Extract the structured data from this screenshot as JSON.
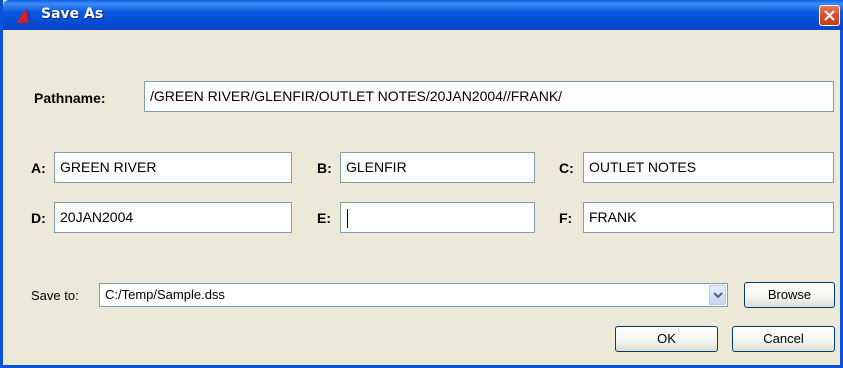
{
  "window": {
    "title": "Save As",
    "app_icon": "triangle-app-icon",
    "close_icon": "close-icon"
  },
  "pathname": {
    "label": "Pathname:",
    "value": "/GREEN RIVER/GLENFIR/OUTLET NOTES/20JAN2004//FRANK/"
  },
  "parts": {
    "a": {
      "label": "A:",
      "value": "GREEN RIVER"
    },
    "b": {
      "label": "B:",
      "value": "GLENFIR"
    },
    "c": {
      "label": "C:",
      "value": "OUTLET NOTES"
    },
    "d": {
      "label": "D:",
      "value": "20JAN2004"
    },
    "e": {
      "label": "E:",
      "value": ""
    },
    "f": {
      "label": "F:",
      "value": "FRANK"
    }
  },
  "save_to": {
    "label": "Save to:",
    "value": "C:/Temp/Sample.dss",
    "browse_label": "Browse"
  },
  "buttons": {
    "ok": "OK",
    "cancel": "Cancel"
  },
  "colors": {
    "titlebar": "#0a58e0",
    "dialog_bg": "#ece9d8",
    "field_border": "#7f9db9",
    "close_button": "#d6502c"
  }
}
